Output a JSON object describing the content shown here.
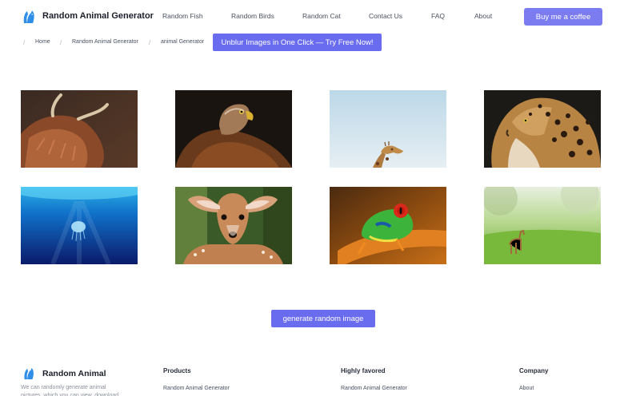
{
  "header": {
    "brand": "Random Animal Generator",
    "nav": [
      "Random Fish",
      "Random Birds",
      "Random Cat",
      "Contact Us",
      "FAQ",
      "About"
    ],
    "cta_label": "Buy me a coffee"
  },
  "breadcrumb": {
    "items": [
      "Home",
      "Random Animal Generator",
      "animal Generator"
    ],
    "promo_label": "Unblur Images in One Click — Try Free Now!"
  },
  "gallery": {
    "images": [
      {
        "animal": "highland-cow"
      },
      {
        "animal": "eagle"
      },
      {
        "animal": "giraffe"
      },
      {
        "animal": "leopard"
      },
      {
        "animal": "jellyfish"
      },
      {
        "animal": "deer"
      },
      {
        "animal": "tree-frog"
      },
      {
        "animal": "fawn"
      }
    ]
  },
  "generate_label": "generate random image",
  "footer": {
    "brand": "Random Animal",
    "description": "We can randomly generate animal pictures, which you can view, download",
    "columns": [
      {
        "title": "Products",
        "links": [
          "Random Animal Generator"
        ]
      },
      {
        "title": "Highly favored",
        "links": [
          "Random Animal Generator"
        ]
      },
      {
        "title": "Company",
        "links": [
          "About"
        ]
      }
    ]
  },
  "colors": {
    "accent": "#6a6cf0",
    "accent_light": "#7b7cf0",
    "logo": "#2f8fe8"
  }
}
